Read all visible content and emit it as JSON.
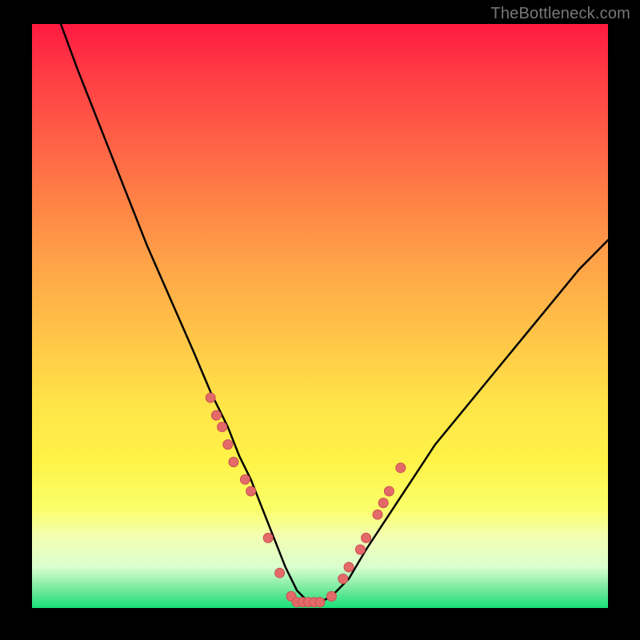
{
  "watermark": "TheBottleneck.com",
  "chart_data": {
    "type": "line",
    "title": "",
    "xlabel": "",
    "ylabel": "",
    "xlim": [
      0,
      100
    ],
    "ylim": [
      0,
      100
    ],
    "series": [
      {
        "name": "curve",
        "x": [
          5,
          8,
          12,
          16,
          20,
          24,
          28,
          31,
          34,
          36,
          38,
          40,
          42,
          44,
          46,
          48,
          50,
          52,
          55,
          58,
          62,
          66,
          70,
          75,
          80,
          85,
          90,
          95,
          100
        ],
        "y": [
          100,
          92,
          82,
          72,
          62,
          53,
          44,
          37,
          31,
          26,
          22,
          17,
          12,
          7,
          3,
          1,
          1,
          2,
          5,
          10,
          16,
          22,
          28,
          34,
          40,
          46,
          52,
          58,
          63
        ]
      }
    ],
    "markers": {
      "name": "points",
      "x": [
        31,
        32,
        33,
        34,
        35,
        37,
        38,
        41,
        43,
        45,
        46,
        47,
        48,
        49,
        50,
        52,
        54,
        55,
        57,
        58,
        60,
        61,
        62,
        64
      ],
      "y": [
        36,
        33,
        31,
        28,
        25,
        22,
        20,
        12,
        6,
        2,
        1,
        1,
        1,
        1,
        1,
        2,
        5,
        7,
        10,
        12,
        16,
        18,
        20,
        24
      ]
    },
    "background_gradient": {
      "top": "#ff1a40",
      "mid": "#ffe448",
      "bottom": "#19e07a"
    }
  }
}
